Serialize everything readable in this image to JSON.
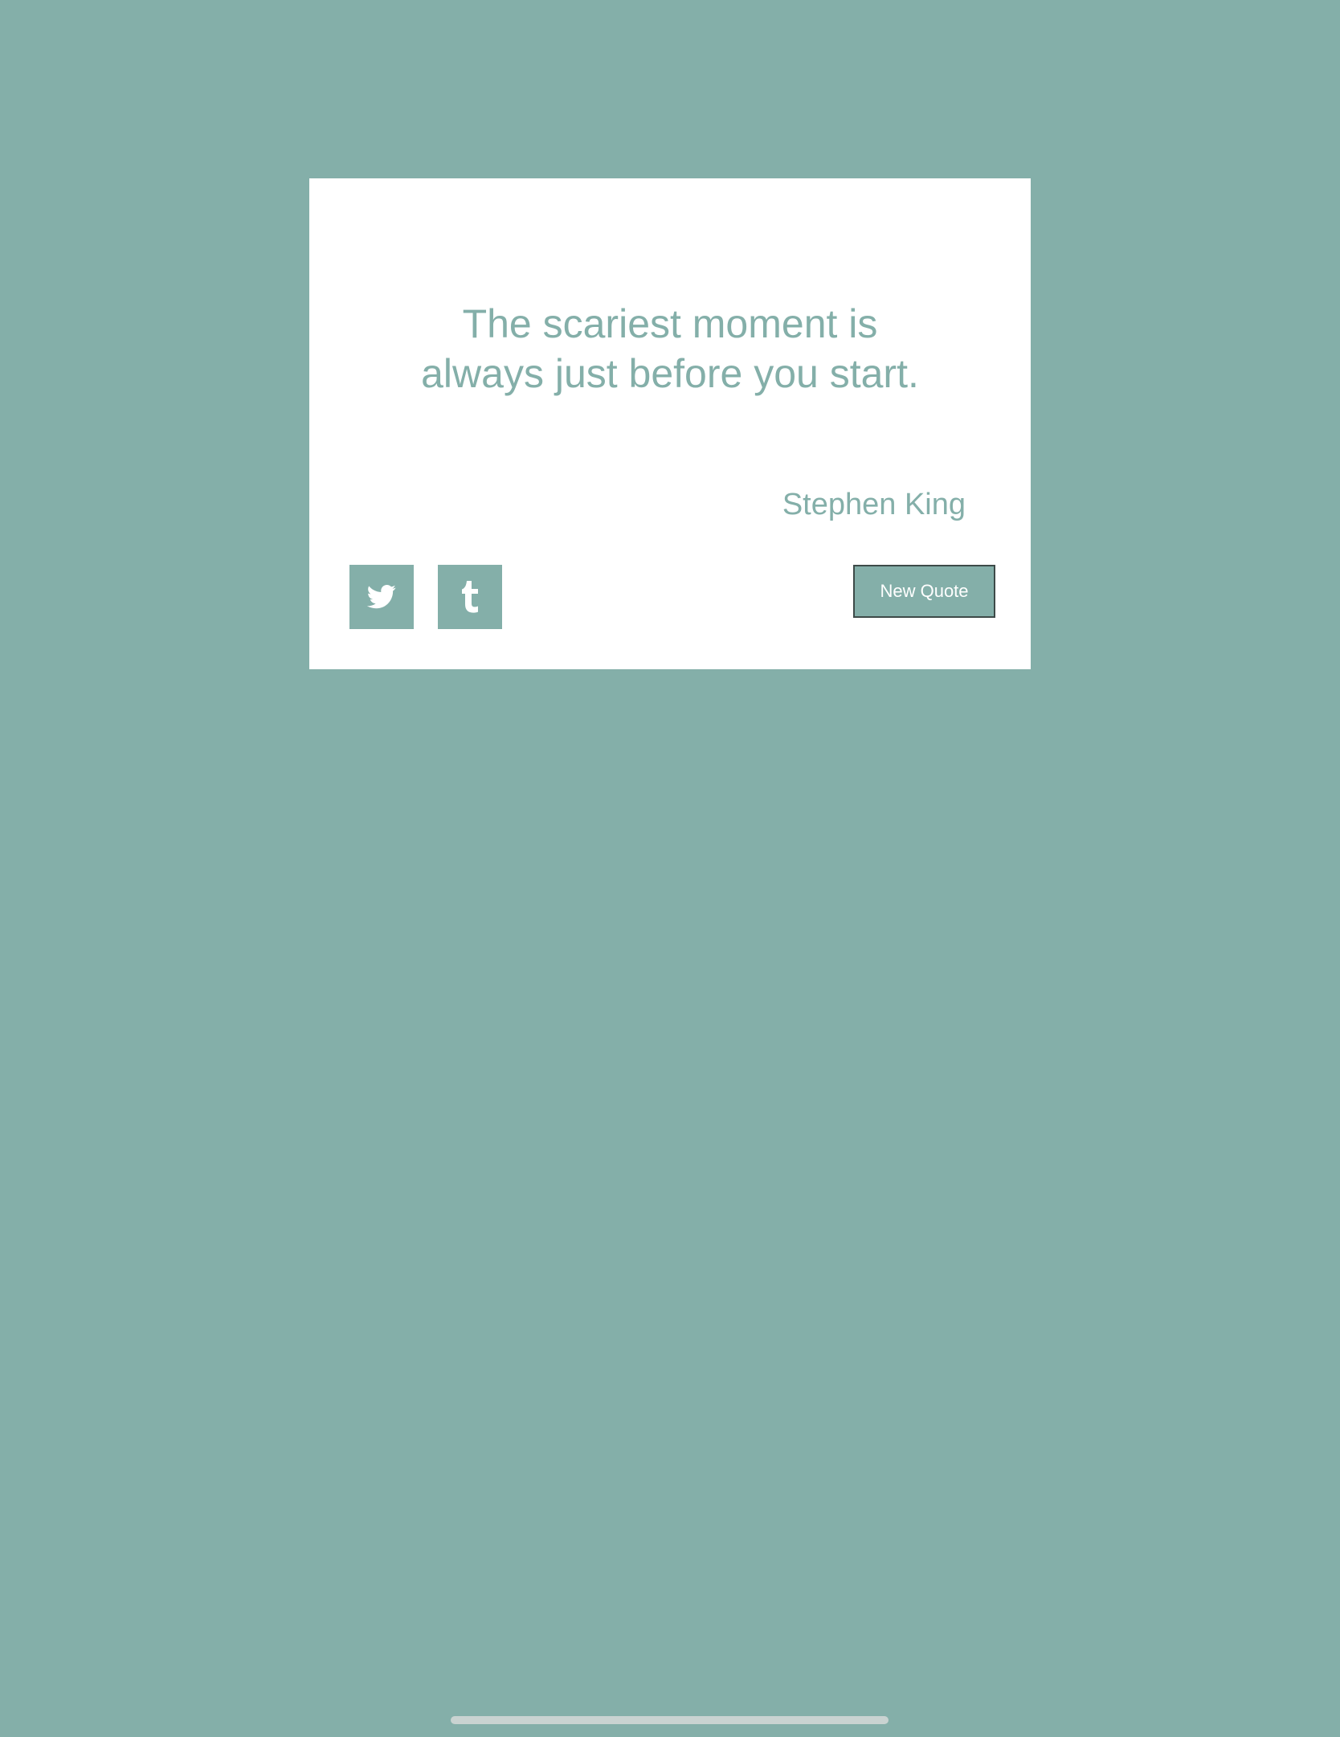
{
  "theme": {
    "background_color": "#84afa9",
    "card_color": "#ffffff",
    "accent_color": "#84afa9",
    "button_border_color": "#3d4a48"
  },
  "quote": {
    "text_line_1": "The scariest moment is",
    "text_line_2": "always just before you start.",
    "author": "Stephen King"
  },
  "actions": {
    "twitter_icon": "twitter-icon",
    "tumblr_icon": "tumblr-icon",
    "new_quote_label": "New Quote"
  }
}
